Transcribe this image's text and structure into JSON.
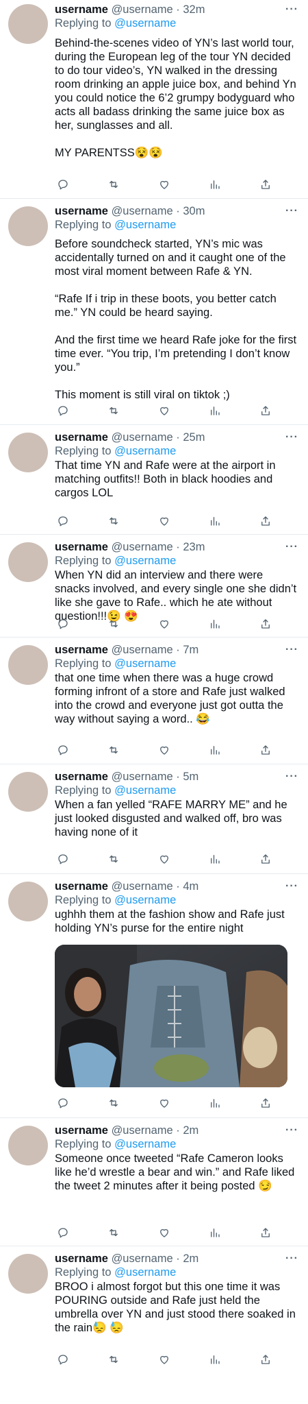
{
  "tweets": [
    {
      "username": "username",
      "handle": "@username",
      "time": "32m",
      "reply_label": "Replying to",
      "reply_handle": "@username",
      "paragraphs": [
        "Behind-the-scenes video of YN’s last world tour, during the European leg of the tour YN decided to do tour video’s, YN walked in the dressing room drinking an apple juice box, and behind Yn you could notice the 6’2 grumpy bodyguard who acts all badass drinking the same juice box as her, sunglasses and all.",
        "MY PARENTSS😵😵"
      ]
    },
    {
      "username": "username",
      "handle": "@username",
      "time": "30m",
      "reply_label": "Replying to",
      "reply_handle": "@username",
      "paragraphs": [
        "Before soundcheck started, YN’s mic was accidentally turned on and it caught one of the most viral moment between Rafe & YN.",
        "“Rafe If i trip in these boots, you better catch me.” YN could be heard saying.",
        "And the first time we heard Rafe joke for the first time ever. “You trip, I’m pretending I don’t know you.”",
        "This moment is still viral on tiktok ;)"
      ]
    },
    {
      "username": "username",
      "handle": "@username",
      "time": "25m",
      "reply_label": "Replying to",
      "reply_handle": "@username",
      "paragraphs": [
        "That time YN and Rafe were at the airport in matching outfits!! Both in black hoodies and cargos LOL"
      ]
    },
    {
      "username": "username",
      "handle": "@username",
      "time": "23m",
      "reply_label": "Replying to",
      "reply_handle": "@username",
      "paragraphs": [
        "When YN did an interview and there were snacks involved, and every single one she didn’t like she gave to Rafe.. which he ate without question!!!😉 😍"
      ]
    },
    {
      "username": "username",
      "handle": "@username",
      "time": "7m",
      "reply_label": "Replying to",
      "reply_handle": "@username",
      "paragraphs": [
        "that one time when there was a huge crowd forming infront of a store and Rafe just walked into the crowd and everyone just got outta the way without saying a word.. 😂"
      ]
    },
    {
      "username": "username",
      "handle": "@username",
      "time": "5m",
      "reply_label": "Replying to",
      "reply_handle": "@username",
      "paragraphs": [
        "When a fan yelled “RAFE MARRY ME” and he just looked disgusted and walked off, bro was having none of it"
      ]
    },
    {
      "username": "username",
      "handle": "@username",
      "time": "4m",
      "reply_label": "Replying to",
      "reply_handle": "@username",
      "paragraphs": [
        "ughhh them at the fashion show and Rafe just holding YN’s purse for the entire night"
      ]
    },
    {
      "username": "username",
      "handle": "@username",
      "time": "2m",
      "reply_label": "Replying to",
      "reply_handle": "@username",
      "paragraphs": [
        "Someone once tweeted “Rafe Cameron looks like he’d wrestle a bear and win.” and Rafe liked the tweet 2 minutes after it being posted 😏"
      ]
    },
    {
      "username": "username",
      "handle": "@username",
      "time": "2m",
      "reply_label": "Replying to",
      "reply_handle": "@username",
      "paragraphs": [
        "BROO i almost forgot but this one time it was POURING outside and Rafe just held the umbrella over YN and just stood there soaked in the rain😓 😓"
      ]
    }
  ],
  "icons": {
    "more": "more-horizontal-icon",
    "reply": "reply-bubble-icon",
    "retweet": "retweet-icon",
    "like": "heart-icon",
    "stats": "bar-chart-icon",
    "share": "share-upload-icon"
  },
  "colors": {
    "text": "#0f1419",
    "secondary": "#536471",
    "link": "#1d9bf0",
    "divider": "#e6ecf0",
    "avatar": "#cdbfb6"
  }
}
